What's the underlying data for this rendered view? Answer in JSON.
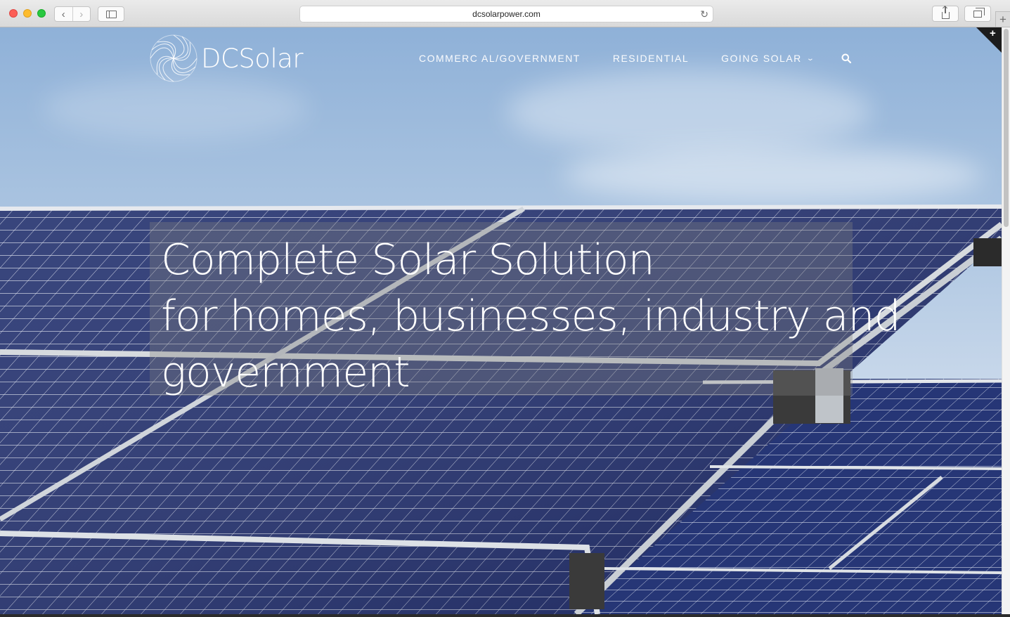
{
  "browser": {
    "url": "dcsolarpower.com",
    "back_icon": "chevron-left-icon",
    "forward_icon": "chevron-right-icon",
    "back_glyph": "‹",
    "forward_glyph": "›",
    "reload_glyph": "↻",
    "new_tab_glyph": "+"
  },
  "site": {
    "logo_text": "DCSolar",
    "nav": {
      "commercial": "COMMERC AL/GOVERNMENT",
      "residential": "RESIDENTIAL",
      "going_solar": "GOING SOLAR",
      "going_solar_chevron": "⌄"
    },
    "corner_plus": "+"
  },
  "hero": {
    "line1": "Complete Solar Solution",
    "line2": "for homes, businesses, industry and",
    "line3": "government"
  },
  "colors": {
    "sky_top": "#8fb1d8",
    "panel_blue": "#1f2e6b",
    "frame_silver": "#d9dde2",
    "text_white": "#ffffff"
  }
}
